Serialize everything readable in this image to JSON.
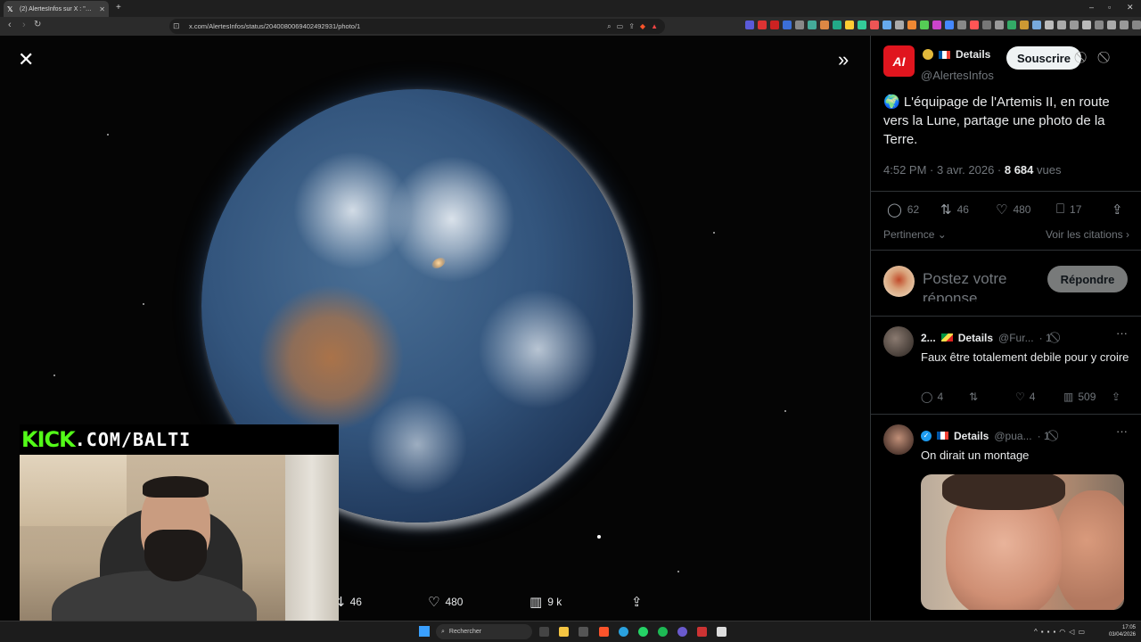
{
  "browser": {
    "tab_title": "(2) AlertesInfos sur X : \"🌍 L'équ",
    "url": "x.com/AlertesInfos/status/2040080069402492931/photo/1"
  },
  "photo_view": {
    "reposts": "46",
    "likes": "480",
    "views": "9 k"
  },
  "webcam": {
    "kick_logo": "KICK",
    "kick_url": ".COM/BALTI"
  },
  "tweet": {
    "author_details": "Details",
    "handle": "@AlertesInfos",
    "subscribe_label": "Souscrire",
    "text": "🌍 L'équipage de l'Artemis II, en route vers la Lune, partage une photo de la Terre.",
    "time": "4:52 PM · 3 avr. 2026 · ",
    "views_count": "8 684",
    "views_label": " vues",
    "stats": {
      "replies": "62",
      "reposts": "46",
      "likes": "480",
      "bookmarks": "17"
    },
    "sort_label": "Pertinence",
    "quotes_label": "Voir les citations",
    "reply_placeholder": "Postez votre réponse",
    "reply_button": "Répondre"
  },
  "comments": [
    {
      "name": "2...",
      "details": "Details",
      "handle": "@Fur...",
      "time": "· 1",
      "text": "Faux être totalement debile pour y croire",
      "replies": "4",
      "likes": "4",
      "views": "509"
    },
    {
      "name": "",
      "details": "Details",
      "handle": "@pua...",
      "time": "· 1",
      "text": "On dirait un montage"
    }
  ],
  "taskbar": {
    "search_placeholder": "Rechercher",
    "time": "17:05",
    "date": "03/04/2026"
  },
  "colors": {
    "kick_green": "#53fc18",
    "alertes_red": "#e0151e",
    "x_blue": "#1d9bf0"
  }
}
